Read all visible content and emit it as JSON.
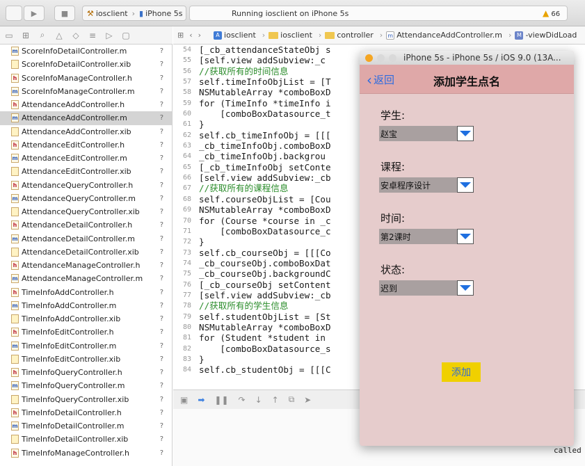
{
  "toolbar": {
    "scheme_target": "iosclient",
    "scheme_device": "iPhone 5s",
    "status": "Running iosclient on iPhone 5s",
    "warning_count": "66"
  },
  "navigator": {
    "files": [
      {
        "name": "ScoreInfoDetailController.m",
        "type": "m",
        "badge": "?"
      },
      {
        "name": "ScoreInfoDetailController.xib",
        "type": "xib",
        "badge": "?"
      },
      {
        "name": "ScoreInfoManageController.h",
        "type": "h",
        "badge": "?"
      },
      {
        "name": "ScoreInfoManageController.m",
        "type": "m",
        "badge": "?"
      },
      {
        "name": "AttendanceAddController.h",
        "type": "h",
        "badge": "?"
      },
      {
        "name": "AttendanceAddController.m",
        "type": "m",
        "badge": "?",
        "selected": true
      },
      {
        "name": "AttendanceAddController.xib",
        "type": "xib",
        "badge": "?"
      },
      {
        "name": "AttendanceEditController.h",
        "type": "h",
        "badge": "?"
      },
      {
        "name": "AttendanceEditController.m",
        "type": "m",
        "badge": "?"
      },
      {
        "name": "AttendanceEditController.xib",
        "type": "xib",
        "badge": "?"
      },
      {
        "name": "AttendanceQueryController.h",
        "type": "h",
        "badge": "?"
      },
      {
        "name": "AttendanceQueryController.m",
        "type": "m",
        "badge": "?"
      },
      {
        "name": "AttendanceQueryController.xib",
        "type": "xib",
        "badge": "?"
      },
      {
        "name": "AttendanceDetailController.h",
        "type": "h",
        "badge": "?"
      },
      {
        "name": "AttendanceDetailController.m",
        "type": "m",
        "badge": "?"
      },
      {
        "name": "AttendanceDetailController.xib",
        "type": "xib",
        "badge": "?"
      },
      {
        "name": "AttendanceManageController.h",
        "type": "h",
        "badge": "?"
      },
      {
        "name": "AttendanceManageController.m",
        "type": "m",
        "badge": "?"
      },
      {
        "name": "TimeInfoAddController.h",
        "type": "h",
        "badge": "?"
      },
      {
        "name": "TimeInfoAddController.m",
        "type": "m",
        "badge": "?"
      },
      {
        "name": "TimeInfoAddController.xib",
        "type": "xib",
        "badge": "?"
      },
      {
        "name": "TimeInfoEditController.h",
        "type": "h",
        "badge": "?"
      },
      {
        "name": "TimeInfoEditController.m",
        "type": "m",
        "badge": "?"
      },
      {
        "name": "TimeInfoEditController.xib",
        "type": "xib",
        "badge": "?"
      },
      {
        "name": "TimeInfoQueryController.h",
        "type": "h",
        "badge": "?"
      },
      {
        "name": "TimeInfoQueryController.m",
        "type": "m",
        "badge": "?"
      },
      {
        "name": "TimeInfoQueryController.xib",
        "type": "xib",
        "badge": "?"
      },
      {
        "name": "TimeInfoDetailController.h",
        "type": "h",
        "badge": "?"
      },
      {
        "name": "TimeInfoDetailController.m",
        "type": "m",
        "badge": "?"
      },
      {
        "name": "TimeInfoDetailController.xib",
        "type": "xib",
        "badge": "?"
      },
      {
        "name": "TimeInfoManageController.h",
        "type": "h",
        "badge": "?"
      }
    ]
  },
  "jumpbar": {
    "items": [
      "iosclient",
      "iosclient",
      "controller",
      "AttendanceAddController.m",
      "-viewDidLoad"
    ]
  },
  "editor": {
    "line_numbers": [
      "54",
      "55",
      "56",
      "57",
      "58",
      "59",
      "60",
      "61",
      "62",
      "63",
      "64",
      "65",
      "66",
      "67",
      "68",
      "69",
      "70",
      "71",
      "72",
      "73",
      "74",
      "75",
      "76",
      "77",
      "78",
      "79",
      "80",
      "81",
      "82",
      "83",
      "84"
    ],
    "lines": [
      "[_cb_attendanceStateObj s",
      "[self.view addSubview:_c",
      "//获取所有的时间信息",
      "self.timeInfoObjList = [T",
      "NSMutableArray *comboBoxD",
      "for (TimeInfo *timeInfo i",
      "    [comboBoxDatasource_t",
      "}",
      "self.cb_timeInfoObj = [[[",
      "_cb_timeInfoObj.comboBoxD",
      "_cb_timeInfoObj.backgrou",
      "[_cb_timeInfoObj setConte",
      "[self.view addSubview:_cb",
      "//获取所有的课程信息",
      "self.courseObjList = [Cou",
      "NSMutableArray *comboBoxD",
      "for (Course *course in _c",
      "    [comboBoxDatasource_c",
      "}",
      "self.cb_courseObj = [[[Co",
      "_cb_courseObj.comboBoxDat",
      "_cb_courseObj.backgroundC",
      "[_cb_courseObj setContent",
      "[self.view addSubview:_cb",
      "//获取所有的学生信息",
      "self.studentObjList = [St",
      "NSMutableArray *comboBoxD",
      "for (Student *student in",
      "    [comboBoxDatasource_s",
      "}",
      "self.cb_studentObj = [[[C"
    ]
  },
  "debug": {
    "console_text": "called"
  },
  "simulator": {
    "title": "iPhone 5s - iPhone 5s / iOS 9.0 (13A...",
    "back_label": "返回",
    "heading": "添加学生点名",
    "fields": [
      {
        "label": "学生:",
        "value": "赵宝"
      },
      {
        "label": "课程:",
        "value": "安卓程序设计"
      },
      {
        "label": "时间:",
        "value": "第2课时"
      },
      {
        "label": "状态:",
        "value": "迟到"
      }
    ],
    "add_button": "添加"
  }
}
